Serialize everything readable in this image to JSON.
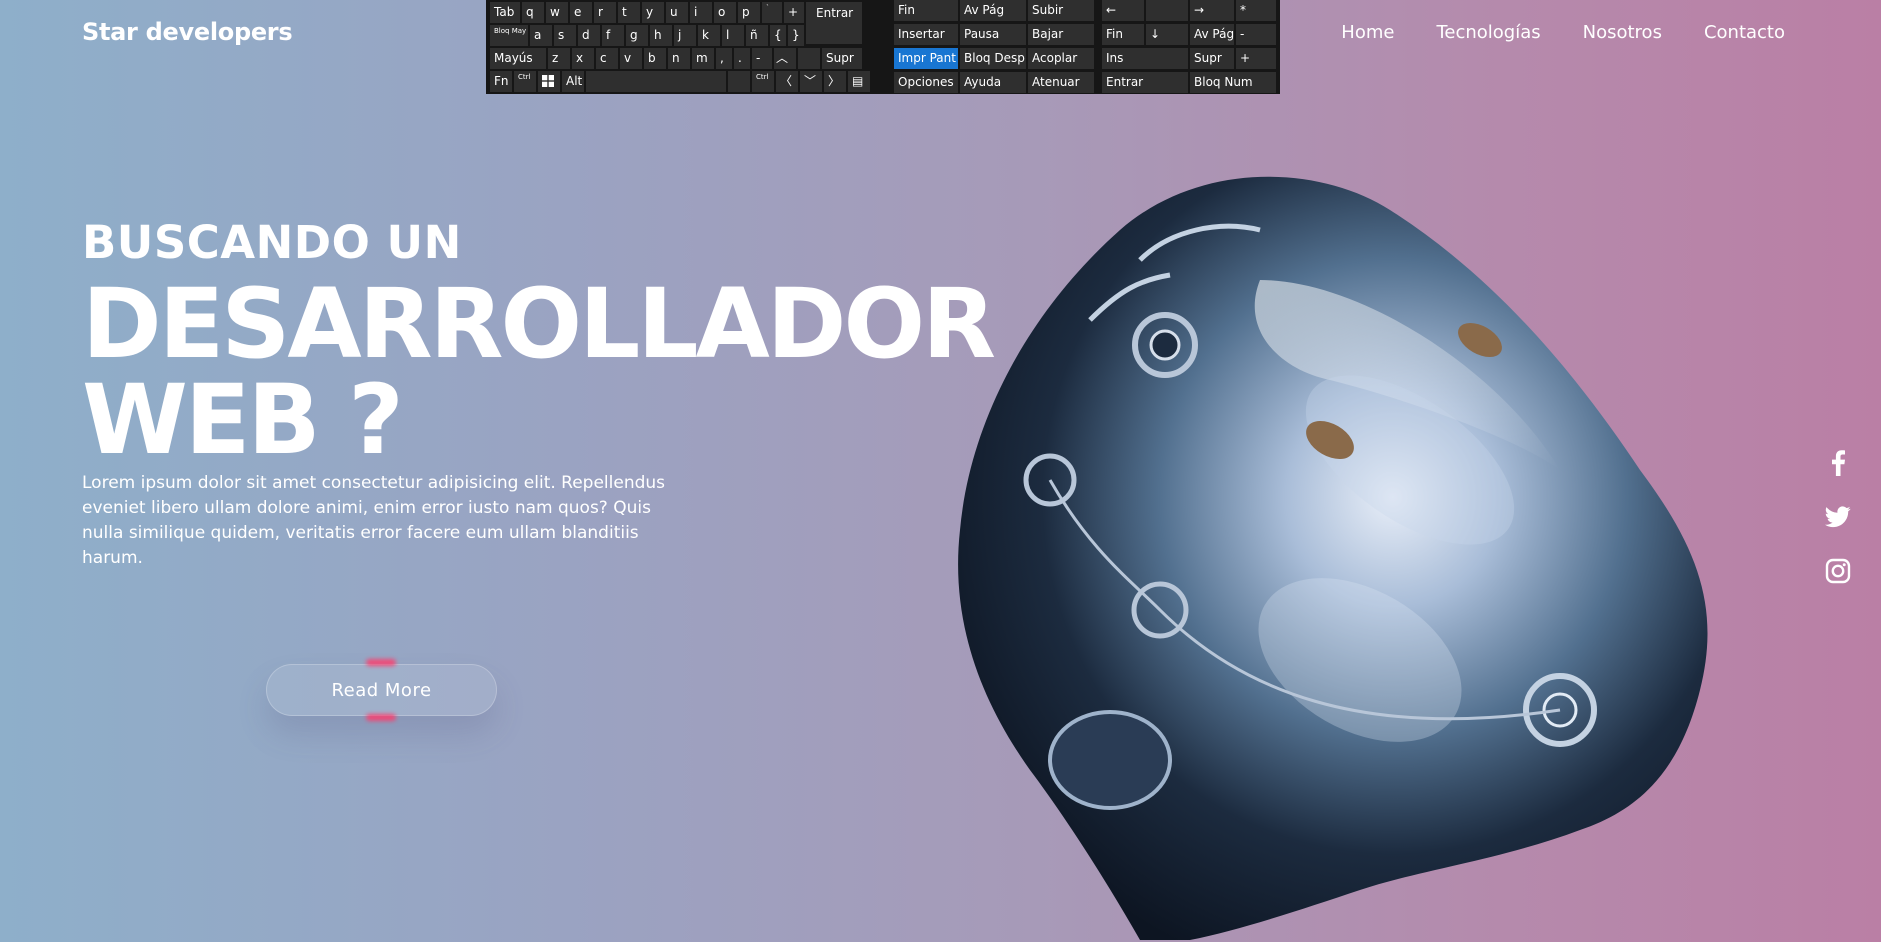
{
  "header": {
    "brand": "Star developers",
    "nav": [
      "Home",
      "Tecnologías",
      "Nosotros",
      "Contacto"
    ]
  },
  "hero": {
    "eyebrow": "BUSCANDO UN",
    "headline_line1": "DESARROLLADOR",
    "headline_line2": "WEB ?",
    "lead": "Lorem ipsum dolor sit amet consectetur adipisicing elit. Repellendus eveniet libero ullam dolore animi, enim error iusto nam quos? Quis nulla similique quidem, veritatis error facere eum ullam blanditiis harum.",
    "cta": "Read More"
  },
  "social": [
    "facebook-icon",
    "twitter-icon",
    "instagram-icon"
  ],
  "keyboard": {
    "row1": [
      "Tab",
      "q",
      "w",
      "e",
      "r",
      "t",
      "y",
      "u",
      "i",
      "o",
      "p",
      "`",
      "+",
      "Entrar"
    ],
    "row2": [
      "Bloq May",
      "a",
      "s",
      "d",
      "f",
      "g",
      "h",
      "j",
      "k",
      "l",
      "ñ",
      "{",
      "}"
    ],
    "row3": [
      "Mayús",
      "z",
      "x",
      "c",
      "v",
      "b",
      "n",
      "m",
      ",",
      ".",
      "-",
      "Supr"
    ],
    "row4": [
      "Fn",
      "Ctrl",
      "Alt",
      "Ctrl"
    ],
    "nav_keys": [
      [
        "Fin",
        "Av Pág",
        "Subir"
      ],
      [
        "Insertar",
        "Pausa",
        "Bajar"
      ],
      [
        "Impr Pant",
        "Bloq Despl",
        "Acoplar"
      ],
      [
        "Opciones",
        "Ayuda",
        "Atenuar"
      ]
    ],
    "numpad": [
      [
        "←",
        "",
        "→",
        "*"
      ],
      [
        "Fin",
        "↓",
        "Av Pág",
        "-"
      ],
      [
        "Ins",
        "",
        "Supr",
        "+"
      ],
      [
        "Entrar",
        "",
        "Bloq Num",
        ""
      ]
    ],
    "selected_key": "Impr Pant"
  },
  "colors": {
    "bg_left": "#8eafca",
    "bg_right": "#ba7fa5",
    "glow": "#ff3b6b",
    "key_selected": "#1976d2"
  }
}
